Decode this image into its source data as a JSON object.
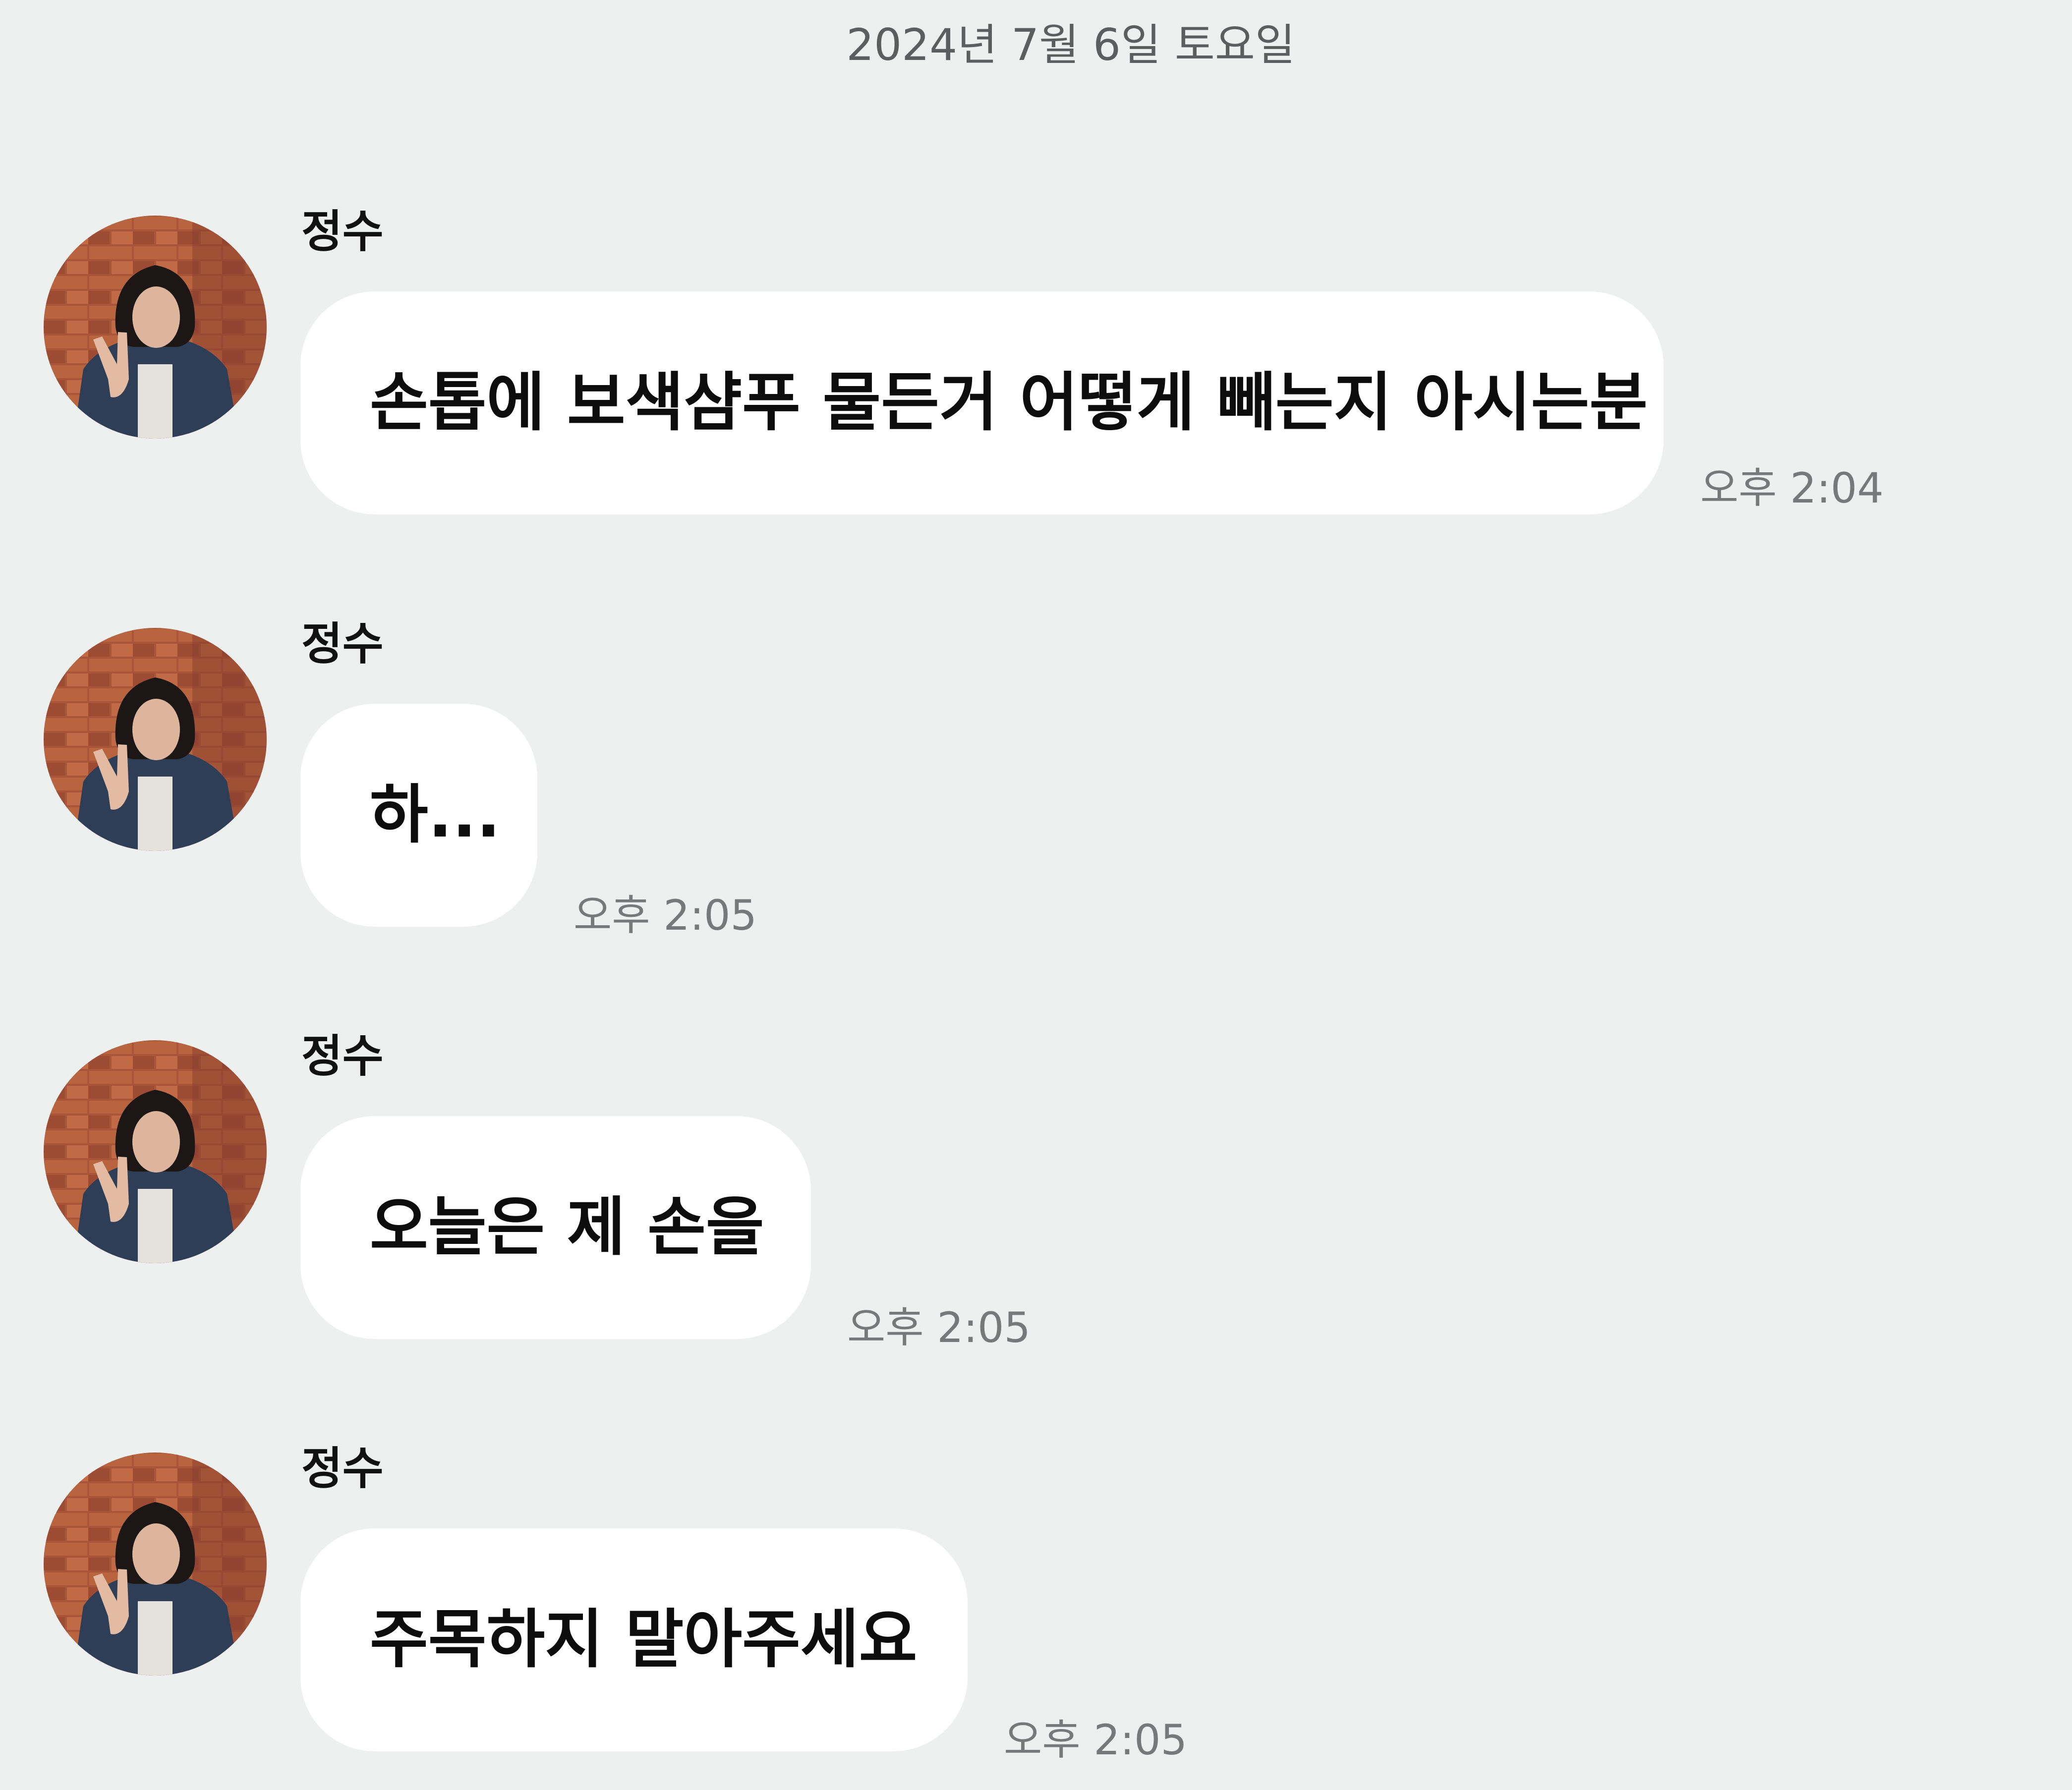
{
  "date_divider": "2024년 7월 6일 토요일",
  "messages": [
    {
      "sender": "정수",
      "text": "손톱에 보색샴푸 물든거 어떻게 빼는지 아시는분",
      "time": "오후 2:04"
    },
    {
      "sender": "정수",
      "text": "하...",
      "time": "오후 2:05"
    },
    {
      "sender": "정수",
      "text": "오늘은 제 손을",
      "time": "오후 2:05"
    },
    {
      "sender": "정수",
      "text": "주목하지 말아주세요",
      "time": "오후 2:05"
    }
  ],
  "colors": {
    "background": "#eeefef",
    "bubble": "#ffffff",
    "timestamp": "#777879",
    "date_text": "#5c5d5e"
  },
  "icons": {
    "avatar": "profile-photo-avatar"
  }
}
